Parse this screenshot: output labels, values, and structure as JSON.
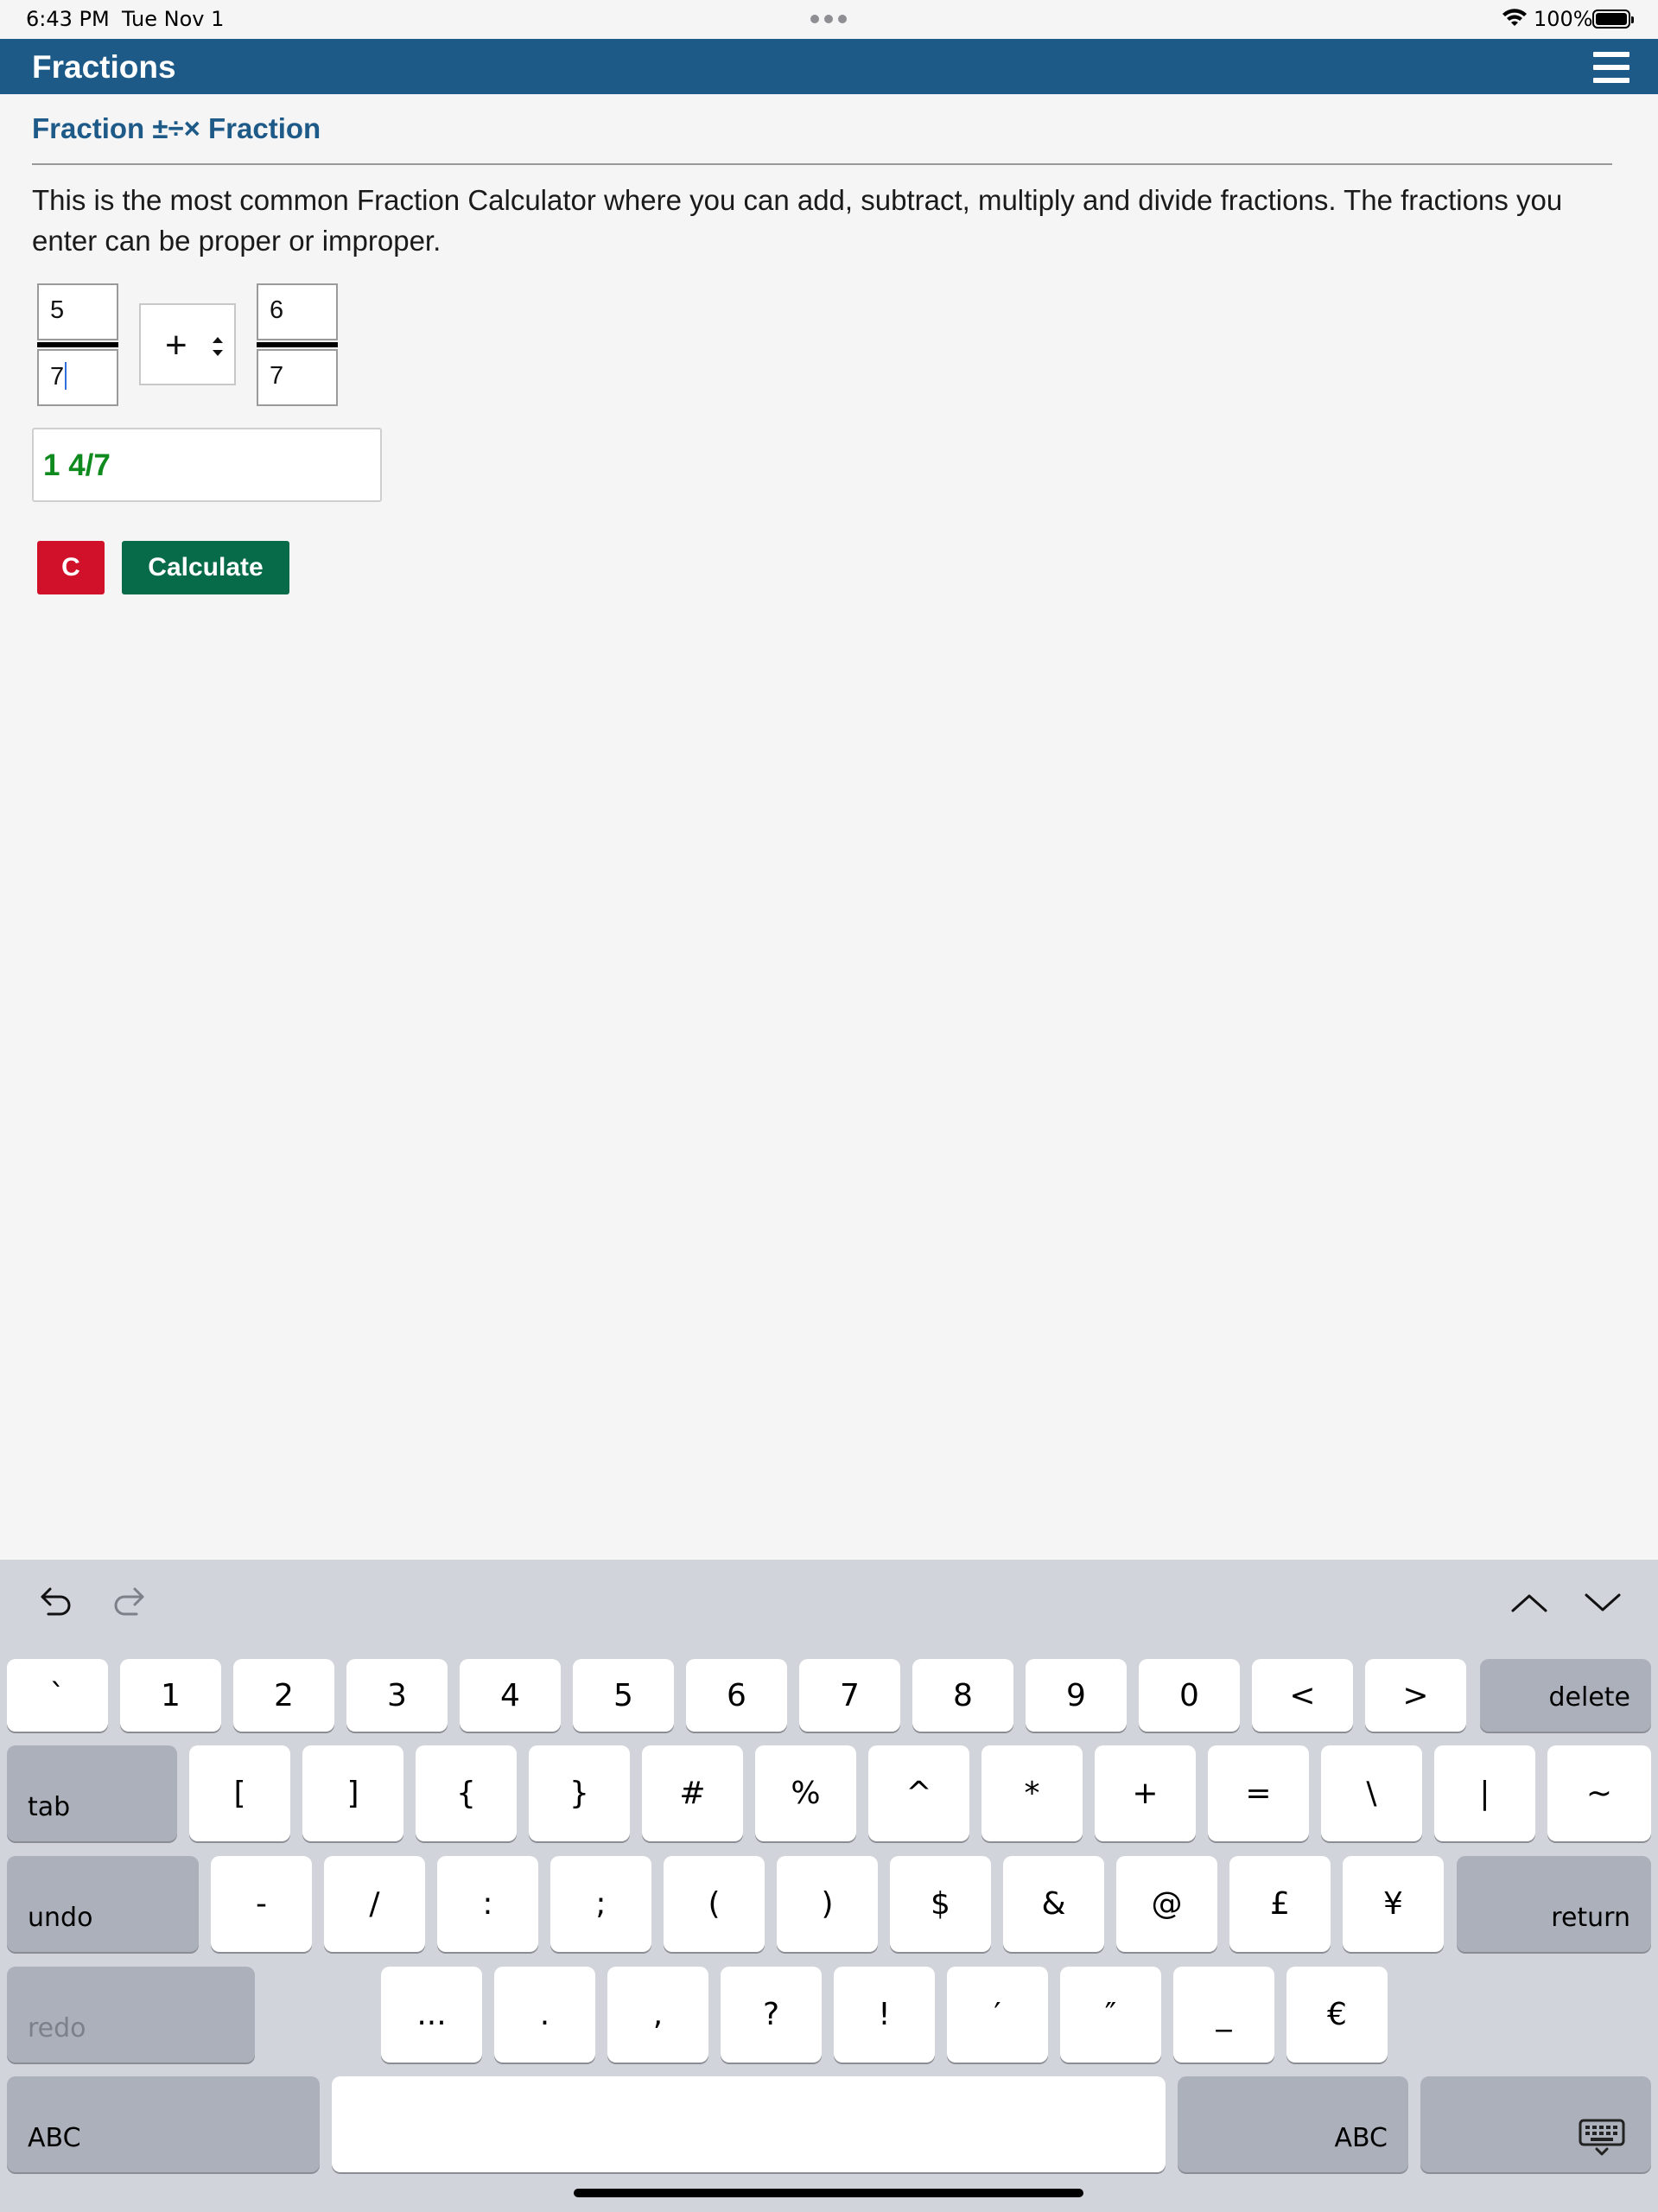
{
  "status": {
    "time": "6:43 PM",
    "date": "Tue Nov 1",
    "battery": "100%"
  },
  "header": {
    "title": "Fractions"
  },
  "calculator": {
    "section_title": "Fraction ±÷× Fraction",
    "description": "This is the most common Fraction Calculator where you can add, subtract, multiply and divide fractions. The fractions you enter can be proper or improper.",
    "fraction1": {
      "numerator": "5",
      "denominator": "7"
    },
    "operator": "+",
    "fraction2": {
      "numerator": "6",
      "denominator": "7"
    },
    "result": "1 4/7",
    "clear_label": "C",
    "calculate_label": "Calculate"
  },
  "keyboard": {
    "row1": [
      "`",
      "1",
      "2",
      "3",
      "4",
      "5",
      "6",
      "7",
      "8",
      "9",
      "0",
      "<",
      ">"
    ],
    "delete": "delete",
    "tab": "tab",
    "row2": [
      "[",
      "]",
      "{",
      "}",
      "#",
      "%",
      "^",
      "*",
      "+",
      "=",
      "\\",
      "|",
      "~"
    ],
    "undo": "undo",
    "row3": [
      "-",
      "/",
      ":",
      ";",
      "(",
      ")",
      "$",
      "&",
      "@",
      "£",
      "¥"
    ],
    "return": "return",
    "redo": "redo",
    "row4": [
      "...",
      ".",
      ",",
      "?",
      "!",
      "′",
      "″",
      "_",
      "€"
    ],
    "abc_left": "ABC",
    "abc_right": "ABC"
  },
  "colors": {
    "header_bg": "#1e5a88",
    "result_text": "#0f8a1e",
    "clear_button": "#d11129",
    "calculate_button": "#076a49"
  },
  "icons": [
    "wifi-icon",
    "battery-icon",
    "menu-icon",
    "select-arrows-icon",
    "undo-icon",
    "redo-icon",
    "chevron-up-icon",
    "chevron-down-icon",
    "keyboard-dismiss-icon"
  ]
}
